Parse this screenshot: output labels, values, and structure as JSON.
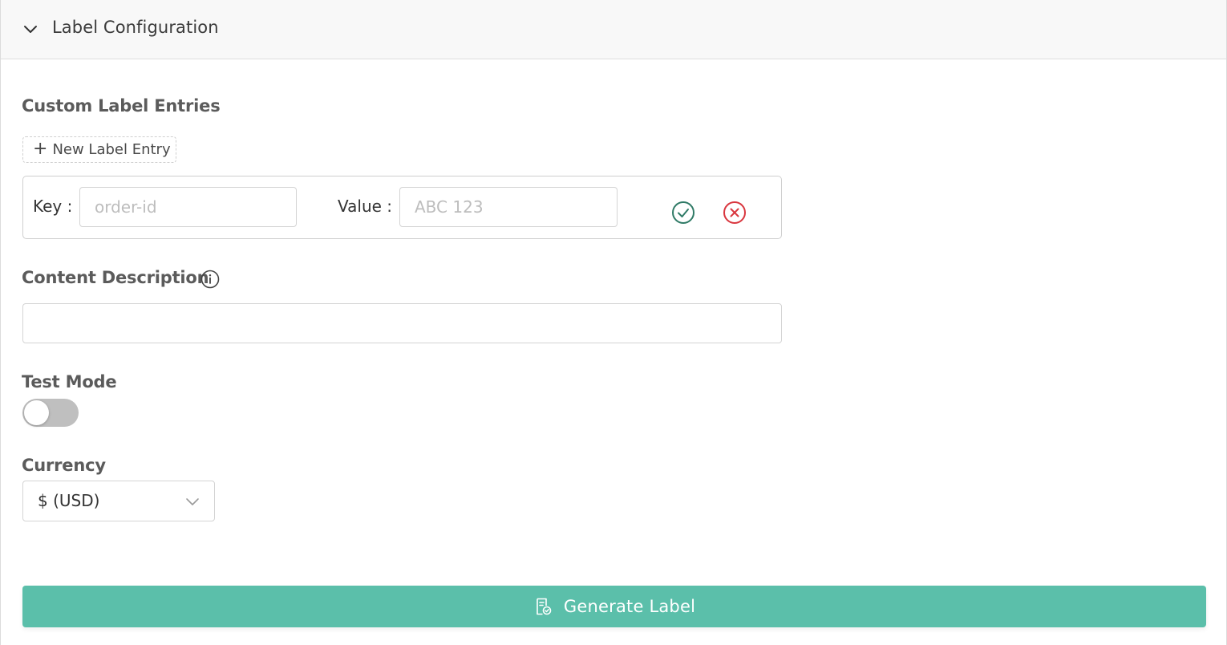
{
  "header": {
    "title": "Label Configuration",
    "toggle_icon": "chevron-down-icon"
  },
  "custom_entries": {
    "title": "Custom Label Entries",
    "new_entry_label": "New Label Entry",
    "new_entry_icon": "plus-icon",
    "row": {
      "key_label": "Key",
      "key_placeholder": "order-id",
      "key_value": "",
      "value_label": "Value",
      "value_placeholder": "ABC 123",
      "value_value": "",
      "confirm_icon": "check-circle-icon",
      "cancel_icon": "x-circle-icon"
    }
  },
  "content_description": {
    "title": "Content Description",
    "info_icon": "info-icon",
    "value": ""
  },
  "test_mode": {
    "title": "Test Mode",
    "enabled": false
  },
  "currency": {
    "title": "Currency",
    "selected": "$ (USD)"
  },
  "generate": {
    "label": "Generate Label",
    "icon": "document-check-icon"
  },
  "colors": {
    "primary": "#5bbfaa",
    "confirm": "#2f7a66",
    "cancel": "#d9363e",
    "toggle_off": "#bfbfbf"
  }
}
